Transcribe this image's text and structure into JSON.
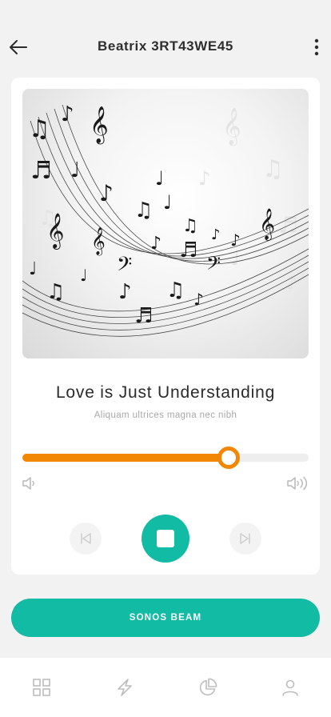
{
  "header": {
    "back_icon": "arrow-left-icon",
    "title": "Beatrix 3RT43WE45",
    "menu_icon": "more-vertical-icon"
  },
  "player": {
    "artwork": "music-notes-artwork",
    "track_title": "Love is Just Understanding",
    "track_subtitle": "Aliquam ultrices magna nec nibh",
    "progress": 0.72,
    "volume_low_icon": "volume-low-icon",
    "volume_high_icon": "volume-high-icon",
    "controls": {
      "previous_icon": "skip-previous-icon",
      "stop_icon": "stop-icon",
      "next_icon": "skip-next-icon"
    }
  },
  "device_button": {
    "label": "SONOS BEAM"
  },
  "bottom_nav": {
    "items": [
      {
        "icon": "grid-icon"
      },
      {
        "icon": "lightning-icon"
      },
      {
        "icon": "pie-chart-icon"
      },
      {
        "icon": "user-icon"
      }
    ]
  },
  "colors": {
    "accent_teal": "#12bba4",
    "accent_orange": "#f28705",
    "background": "#f2f2f2",
    "card": "#ffffff"
  }
}
